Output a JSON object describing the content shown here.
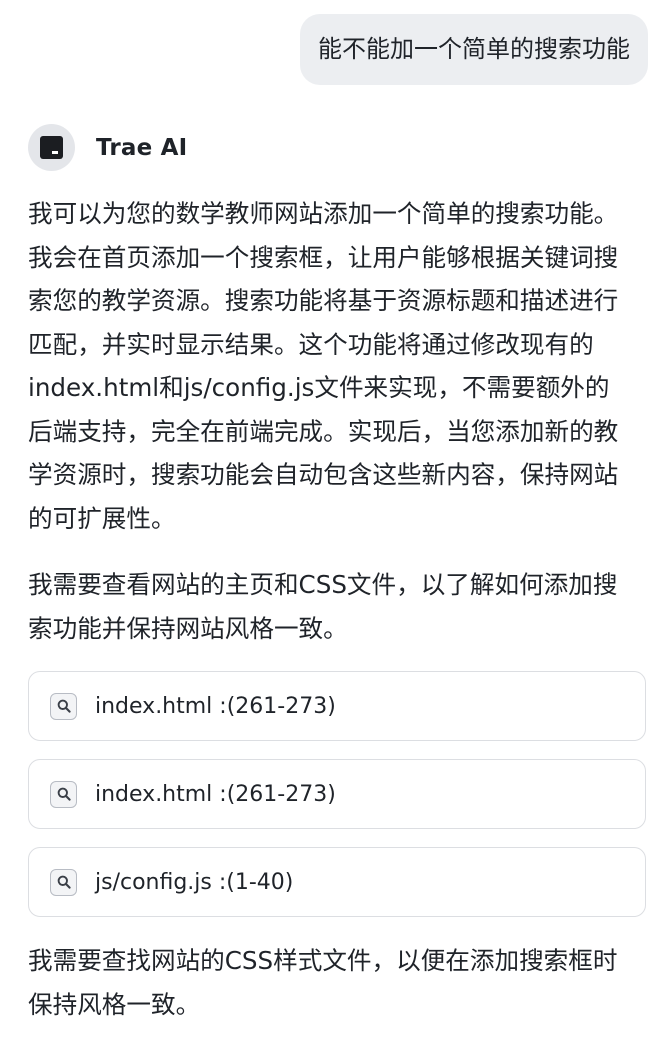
{
  "user_message": {
    "text": "能不能加一个简单的搜索功能"
  },
  "assistant": {
    "name": "Trae AI",
    "avatar_icon": "trae-logo-icon"
  },
  "messages": {
    "intro": "我可以为您的数学教师网站添加一个简单的搜索功能。我会在首页添加一个搜索框，让用户能够根据关键词搜索您的教学资源。搜索功能将基于资源标题和描述进行匹配，并实时显示结果。这个功能将通过修改现有的index.html和js/config.js文件来实现，不需要额外的后端支持，完全在前端完成。实现后，当您添加新的教学资源时，搜索功能会自动包含这些新内容，保持网站的可扩展性。",
    "check_files": "我需要查看网站的主页和CSS文件，以了解如何添加搜索功能并保持网站风格一致。",
    "find_css": "我需要查找网站的CSS样式文件，以便在添加搜索框时保持风格一致。"
  },
  "file_refs": [
    {
      "label": "index.html :(261-273)",
      "icon": "search-file-icon"
    },
    {
      "label": "index.html :(261-273)",
      "icon": "search-file-icon"
    },
    {
      "label": "js/config.js :(1-40)",
      "icon": "search-file-icon"
    }
  ]
}
